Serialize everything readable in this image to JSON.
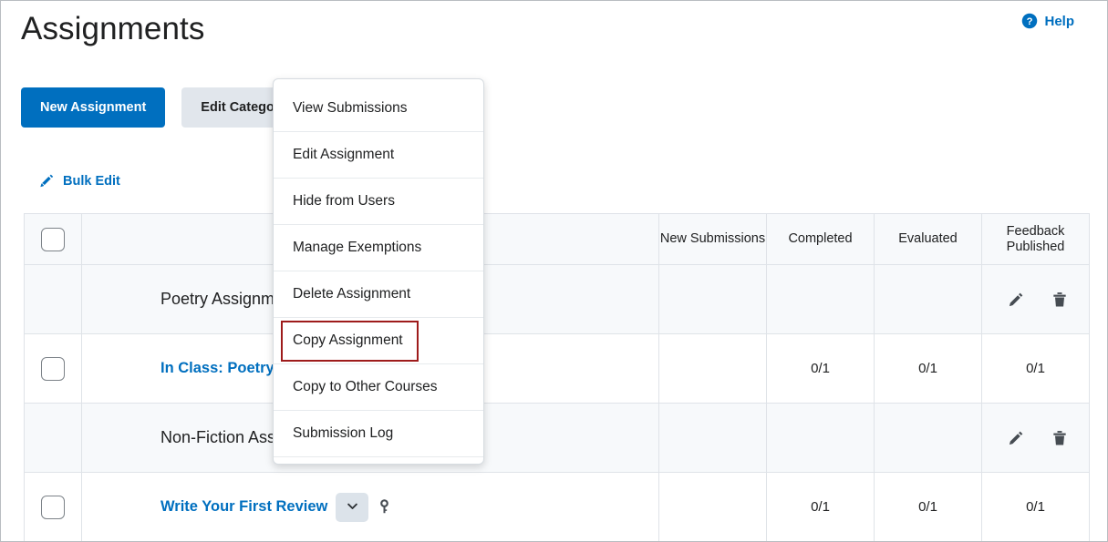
{
  "header": {
    "title": "Assignments",
    "help_label": "Help",
    "help_icon": "help-circle-icon"
  },
  "toolbar": {
    "new_assignment_label": "New Assignment",
    "edit_categories_label": "Edit Categories"
  },
  "bulk_edit": {
    "label": "Bulk Edit",
    "icon": "pencil-icon"
  },
  "table": {
    "columns": [
      {
        "key": "checkbox",
        "label": ""
      },
      {
        "key": "name",
        "label": ""
      },
      {
        "key": "new_submissions",
        "label": "New Submissions"
      },
      {
        "key": "completed",
        "label": "Completed"
      },
      {
        "key": "evaluated",
        "label": "Evaluated"
      },
      {
        "key": "feedback_published",
        "label": "Feedback Published"
      }
    ],
    "rows": [
      {
        "type": "category",
        "name": "Poetry Assignments",
        "new_submissions": "",
        "completed": "",
        "evaluated": "",
        "feedback_published": "",
        "actions": [
          "edit-pencil-icon",
          "delete-trash-icon"
        ]
      },
      {
        "type": "assignment",
        "name": "In Class: Poetry Slam",
        "new_submissions": "",
        "completed": "0/1",
        "evaluated": "0/1",
        "feedback_published": "0/1",
        "has_key_icon": false,
        "menu_open": false
      },
      {
        "type": "category",
        "name": "Non-Fiction Assignments",
        "new_submissions": "",
        "completed": "",
        "evaluated": "",
        "feedback_published": "",
        "actions": [
          "edit-pencil-icon",
          "delete-trash-icon"
        ]
      },
      {
        "type": "assignment",
        "name": "Write Your First Review",
        "new_submissions": "",
        "completed": "0/1",
        "evaluated": "0/1",
        "feedback_published": "0/1",
        "has_key_icon": true,
        "menu_open": true
      }
    ]
  },
  "context_menu": {
    "items": [
      "View Submissions",
      "Edit Assignment",
      "Hide from Users",
      "Manage Exemptions",
      "Delete Assignment",
      "Copy Assignment",
      "Copy to Other Courses",
      "Submission Log"
    ],
    "highlighted_item": "Copy Assignment"
  },
  "colors": {
    "primary_button": "#006fbf",
    "link": "#006fbf",
    "secondary_button": "#e1e6ec",
    "highlight_border": "#9e1b1b",
    "row_category_bg": "#f7f9fb",
    "table_border": "#dfe3e8"
  }
}
